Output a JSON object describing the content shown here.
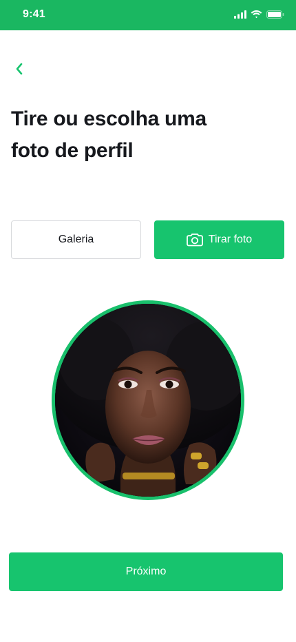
{
  "status_bar": {
    "time": "9:41",
    "icons": [
      "cellular-signal-icon",
      "wifi-icon",
      "battery-icon"
    ]
  },
  "header": {
    "back_icon": "chevron-left-icon"
  },
  "title": {
    "line1": "Tire ou escolha uma",
    "line2": "foto de perfil"
  },
  "actions": {
    "gallery_label": "Galeria",
    "camera_label": "Tirar foto",
    "camera_icon": "camera-icon"
  },
  "profile_photo": {
    "description_icon": "profile-photo"
  },
  "footer": {
    "next_label": "Próximo"
  },
  "colors": {
    "brand_green": "#17c46e",
    "status_bar_green": "#1ab761",
    "text_dark": "#16181d",
    "border_gray": "#d7d9dc"
  }
}
